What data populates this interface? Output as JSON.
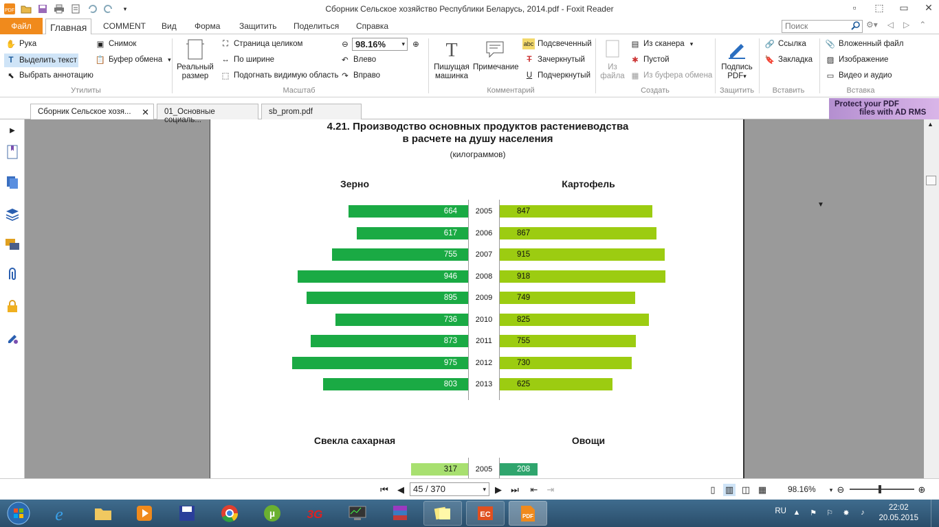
{
  "window": {
    "title": "Сборник Сельское хозяйство Республики Беларусь, 2014.pdf - Foxit Reader"
  },
  "menu": {
    "file": "Файл",
    "tabs": [
      "Главная",
      "COMMENT",
      "Вид",
      "Форма",
      "Защитить",
      "Поделиться",
      "Справка"
    ],
    "search_placeholder": "Поиск"
  },
  "ribbon": {
    "utilities": {
      "hand": "Рука",
      "select_text": "Выделить текст",
      "select_annotation": "Выбрать аннотацию",
      "snapshot": "Снимок",
      "clipboard": "Буфер обмена",
      "group": "Утилиты"
    },
    "scale": {
      "actual_size_1": "Реальный",
      "actual_size_2": "размер",
      "fit_page": "Страница целиком",
      "fit_width": "По ширине",
      "fit_visible": "Подогнать видимую область",
      "zoom_value": "98.16%",
      "rotate_left": "Влево",
      "rotate_right": "Вправо",
      "group": "Масштаб"
    },
    "comment": {
      "typewriter_1": "Пишущая",
      "typewriter_2": "машинка",
      "note": "Примечание",
      "highlight": "Подсвеченный",
      "strikeout": "Зачеркнутый",
      "underline": "Подчеркнутый",
      "group": "Комментарий"
    },
    "create": {
      "from_file_1": "Из",
      "from_file_2": "файла",
      "from_scanner": "Из сканера",
      "blank": "Пустой",
      "from_clipboard": "Из буфера обмена",
      "group": "Создать"
    },
    "protect": {
      "sign_1": "Подпись",
      "sign_2": "PDF",
      "group": "Защитить"
    },
    "insert": {
      "link": "Ссылка",
      "bookmark": "Закладка",
      "group": "Вставить"
    },
    "embed": {
      "attachment": "Вложенный файл",
      "image": "Изображение",
      "video": "Видео и аудио",
      "group": "Вставка"
    }
  },
  "doc_tabs": [
    {
      "label": "Сборник Сельское хозя...",
      "active": true
    },
    {
      "label": "01_Основные социаль...",
      "active": false
    },
    {
      "label": "sb_prom.pdf",
      "active": false
    }
  ],
  "promo": {
    "line1": "Protect your PDF",
    "line2": "files with AD RMS"
  },
  "document": {
    "title_line1": "4.21. Производство основных продуктов растениеводства",
    "title_line2": "в расчете на душу населения",
    "unit": "(килограммов)"
  },
  "chart_data": [
    {
      "type": "bar",
      "orientation": "horizontal-back-to-back",
      "categories": [
        "2005",
        "2006",
        "2007",
        "2008",
        "2009",
        "2010",
        "2011",
        "2012",
        "2013"
      ],
      "series": [
        {
          "name": "Зерно",
          "side": "left",
          "color": "#1aaa44",
          "values": [
            664,
            617,
            755,
            946,
            895,
            736,
            873,
            975,
            803
          ]
        },
        {
          "name": "Картофель",
          "side": "right",
          "color": "#9ccc11",
          "values": [
            847,
            867,
            915,
            918,
            749,
            825,
            755,
            730,
            625
          ]
        }
      ]
    },
    {
      "type": "bar",
      "orientation": "horizontal-back-to-back",
      "categories": [
        "2005"
      ],
      "series": [
        {
          "name": "Свекла сахарная",
          "side": "left",
          "color": "#a8e070",
          "values": [
            317
          ]
        },
        {
          "name": "Овощи",
          "side": "right",
          "color": "#2fa56d",
          "values": [
            208
          ]
        }
      ]
    }
  ],
  "statusbar": {
    "page_indicator": "45 / 370",
    "zoom": "98.16%"
  },
  "taskbar": {
    "language": "RU",
    "time": "22:02",
    "date": "20.05.2015"
  }
}
